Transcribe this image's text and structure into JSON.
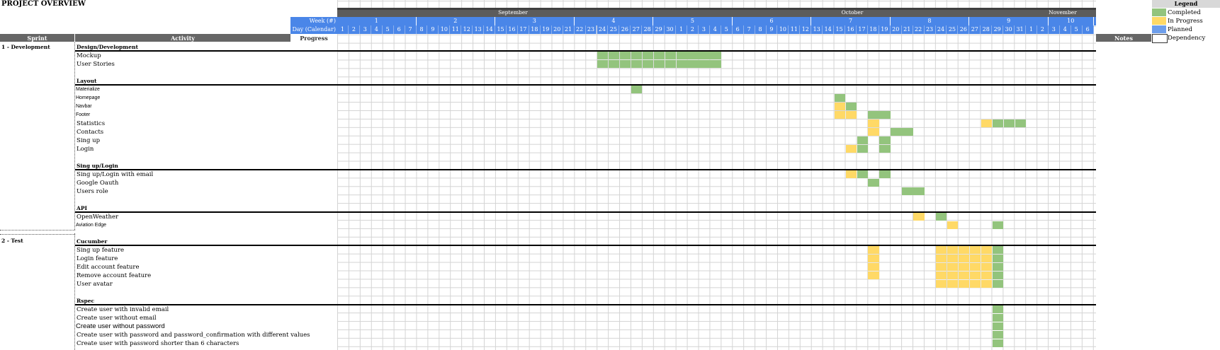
{
  "title": "PROJECT OVERVIEW",
  "colors": {
    "completed": "#93c47d",
    "in_progress": "#ffd966",
    "planned": "#6d9eeb",
    "header_blue": "#4a86e8",
    "header_gray": "#666666"
  },
  "months": [
    "September",
    "October",
    "November"
  ],
  "week_label": "Week (#)",
  "day_label": "Day (Calendar)",
  "weeks": [
    "1",
    "2",
    "3",
    "4",
    "5",
    "6",
    "7",
    "8",
    "9",
    "10"
  ],
  "days": [
    "1",
    "2",
    "3",
    "4",
    "5",
    "6",
    "7",
    "8",
    "9",
    "10",
    "11",
    "12",
    "13",
    "14",
    "15",
    "16",
    "17",
    "18",
    "19",
    "20",
    "21",
    "22",
    "23",
    "24",
    "25",
    "26",
    "27",
    "28",
    "29",
    "30",
    "1",
    "2",
    "3",
    "4",
    "5",
    "6",
    "7",
    "8",
    "9",
    "10",
    "11",
    "12",
    "13",
    "14",
    "15",
    "16",
    "17",
    "18",
    "19",
    "20",
    "21",
    "22",
    "23",
    "24",
    "25",
    "26",
    "27",
    "28",
    "29",
    "30",
    "31",
    "1",
    "2",
    "3",
    "4",
    "5",
    "6"
  ],
  "columns": {
    "sprint": "Sprint",
    "activity": "Activity",
    "progress": "Progress",
    "notes": "Notes"
  },
  "sprints": [
    "1 - Development",
    "2 - Test"
  ],
  "groups": [
    "Design/Development",
    "Layout",
    "Sing up/Login",
    "API",
    "Cucumber",
    "Rspec"
  ],
  "activities": [
    "Mockup",
    "User Stories",
    "Materialize",
    "Homepage",
    "Navbar",
    "Footer",
    "Statistics",
    "Contacts",
    "Sing up",
    "Login",
    "Sing up/Login with email",
    "Google Oauth",
    "Users role",
    "OpenWeather",
    "Aviation Edge",
    "Sing up feature",
    "Login feature",
    "Edit account feature",
    "Remove account feature",
    "User avatar",
    "Create user with invalid email",
    "Create user without email",
    "Create user without password",
    "Create user with password and password_confirmation with different values",
    "Create user with password shorter than 6 characters"
  ],
  "legend": {
    "title": "Legend",
    "completed": "Completed",
    "in_progress": "In Progress",
    "planned": "Planned",
    "dependency": "Dependency"
  },
  "schedule": [
    {
      "activity": "Mockup",
      "completed": [
        "Sep 24 - Oct 4"
      ]
    },
    {
      "activity": "User Stories",
      "completed": [
        "Sep 24 - Oct 4"
      ]
    },
    {
      "activity": "Materialize",
      "completed": [
        "Sep 27"
      ]
    },
    {
      "activity": "Homepage",
      "completed": [
        "Oct 15"
      ]
    },
    {
      "activity": "Navbar",
      "in_progress": [
        "Oct 15"
      ],
      "completed": [
        "Oct 16"
      ]
    },
    {
      "activity": "Footer",
      "in_progress": [
        "Oct 15 - Oct 16"
      ],
      "completed": [
        "Oct 18 - Oct 19"
      ]
    },
    {
      "activity": "Statistics",
      "in_progress": [
        "Oct 18",
        "Oct 28"
      ],
      "completed": [
        "Oct 29 - Oct 31"
      ]
    },
    {
      "activity": "Contacts",
      "in_progress": [
        "Oct 18"
      ],
      "completed": [
        "Oct 20 - Oct 21"
      ]
    },
    {
      "activity": "Sing up",
      "completed": [
        "Oct 17",
        "Oct 19"
      ]
    },
    {
      "activity": "Login",
      "in_progress": [
        "Oct 16"
      ],
      "completed": [
        "Oct 17",
        "Oct 19"
      ]
    },
    {
      "activity": "Sing up/Login with email",
      "in_progress": [
        "Oct 16"
      ],
      "completed": [
        "Oct 17",
        "Oct 19"
      ]
    },
    {
      "activity": "Google Oauth",
      "completed": [
        "Oct 18"
      ]
    },
    {
      "activity": "Users role",
      "completed": [
        "Oct 21 - Oct 22"
      ]
    },
    {
      "activity": "OpenWeather",
      "in_progress": [
        "Oct 22"
      ],
      "completed": [
        "Oct 24"
      ]
    },
    {
      "activity": "Aviation Edge",
      "in_progress": [
        "Oct 25"
      ],
      "completed": [
        "Oct 29"
      ]
    },
    {
      "activity": "Sing up feature",
      "in_progress": [
        "Oct 18",
        "Oct 24 - Oct 28"
      ],
      "completed": [
        "Oct 29"
      ]
    },
    {
      "activity": "Login feature",
      "in_progress": [
        "Oct 18",
        "Oct 24 - Oct 28"
      ],
      "completed": [
        "Oct 29"
      ]
    },
    {
      "activity": "Edit account feature",
      "in_progress": [
        "Oct 18",
        "Oct 24 - Oct 28"
      ],
      "completed": [
        "Oct 29"
      ]
    },
    {
      "activity": "Remove account feature",
      "in_progress": [
        "Oct 18",
        "Oct 24 - Oct 28"
      ],
      "completed": [
        "Oct 29"
      ]
    },
    {
      "activity": "User avatar",
      "in_progress": [
        "Oct 24 - Oct 28"
      ],
      "completed": [
        "Oct 29"
      ]
    },
    {
      "activity": "Create user with invalid email",
      "completed": [
        "Oct 29"
      ]
    },
    {
      "activity": "Create user without email",
      "completed": [
        "Oct 29"
      ]
    },
    {
      "activity": "Create user without password",
      "completed": [
        "Oct 29"
      ]
    },
    {
      "activity": "Create user with password and password_confirmation with different values",
      "completed": [
        "Oct 29"
      ]
    },
    {
      "activity": "Create user with password shorter than 6 characters",
      "completed": [
        "Oct 29"
      ]
    }
  ]
}
